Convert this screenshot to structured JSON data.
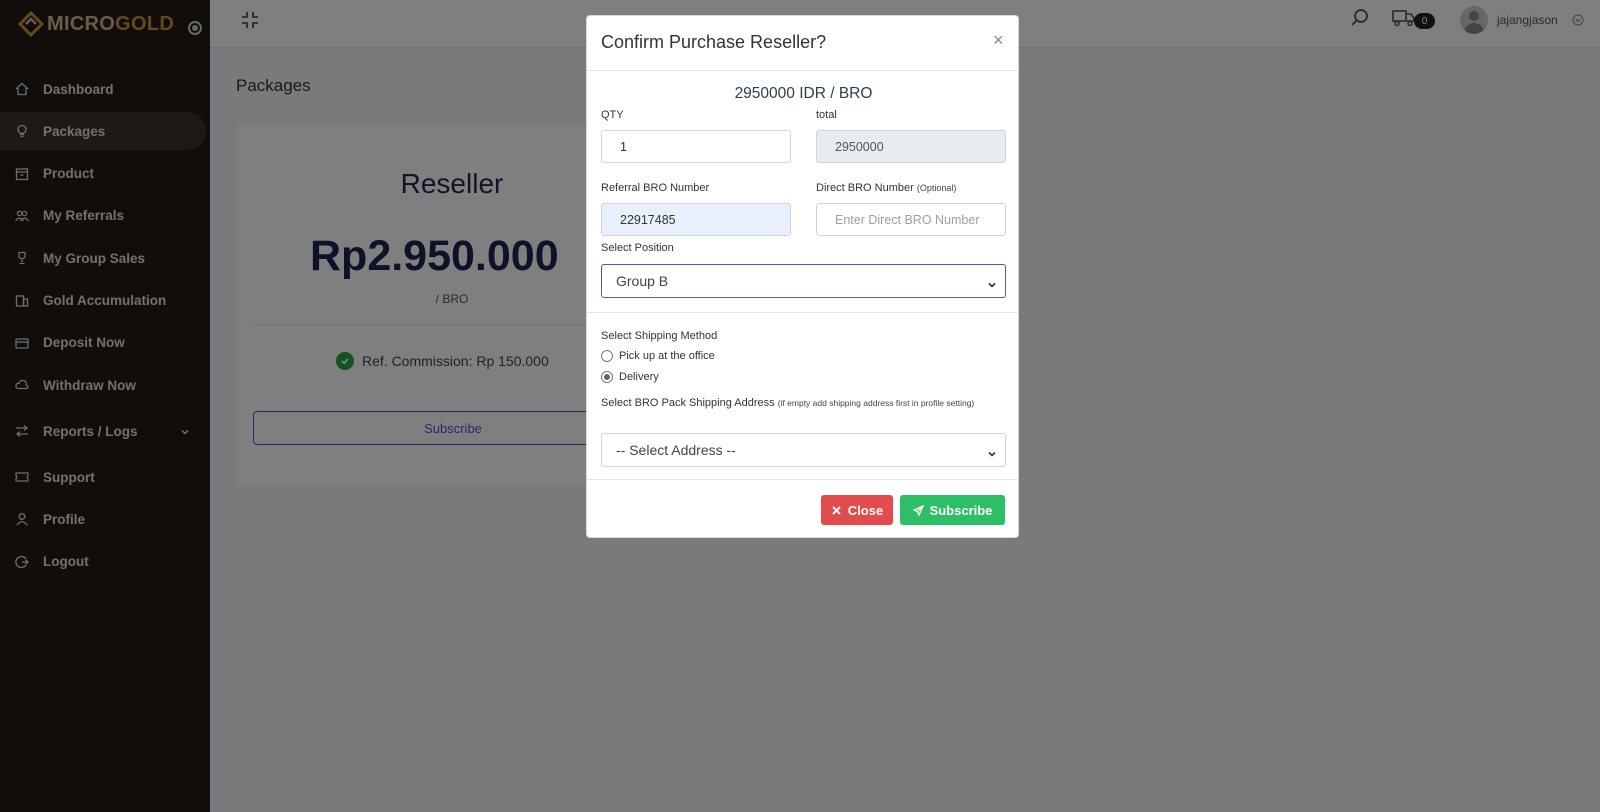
{
  "brand": {
    "name_part1": "MICRO",
    "name_part2": "GOLD"
  },
  "sidebar": {
    "items": [
      {
        "label": "Dashboard",
        "icon": "home-icon"
      },
      {
        "label": "Packages",
        "icon": "lightbulb-icon",
        "active": true
      },
      {
        "label": "Product",
        "icon": "box-icon"
      },
      {
        "label": "My Referrals",
        "icon": "users-icon"
      },
      {
        "label": "My Group Sales",
        "icon": "trophy-icon"
      },
      {
        "label": "Gold Accumulation",
        "icon": "building-icon"
      },
      {
        "label": "Deposit Now",
        "icon": "wallet-icon"
      },
      {
        "label": "Withdraw Now",
        "icon": "cloud-icon"
      },
      {
        "label": "Reports / Logs",
        "icon": "arrows-icon"
      },
      {
        "label": "Support",
        "icon": "ticket-icon"
      },
      {
        "label": "Profile",
        "icon": "user-icon"
      },
      {
        "label": "Logout",
        "icon": "logout-icon"
      }
    ]
  },
  "topbar": {
    "cart_count": "0",
    "username": "jajangjason"
  },
  "page": {
    "title": "Packages"
  },
  "package_card": {
    "name": "Reseller",
    "price": "Rp2.950.000",
    "unit": "/ BRO",
    "commission": "Ref. Commission: Rp 150.000",
    "button": "Subscribe"
  },
  "modal": {
    "title": "Confirm Purchase Reseller?",
    "close_symbol": "×",
    "price_heading": "2950000 IDR / BRO",
    "qty_label": "QTY",
    "qty_value": "1",
    "total_label": "total",
    "total_value": "2950000",
    "referral_label": "Referral BRO Number",
    "referral_value": "22917485",
    "direct_label": "Direct BRO Number",
    "direct_optional": "(Optional)",
    "direct_placeholder": "Enter Direct BRO Number",
    "position_label": "Select Position",
    "position_value": "Group B",
    "shipping_label": "Select Shipping Method",
    "shipping_option1": "Pick up at the office",
    "shipping_option2": "Delivery",
    "address_label": "Select BRO Pack Shipping Address",
    "address_hint": "(if empty add shipping address first in profile setting)",
    "address_value": "-- Select Address --",
    "close_button": "Close",
    "subscribe_button": "Subscribe"
  },
  "colors": {
    "sidebar_bg": "#221b17",
    "accent": "#5a4fcf",
    "close": "#e24c4c",
    "subscribe": "#2dbf65"
  }
}
